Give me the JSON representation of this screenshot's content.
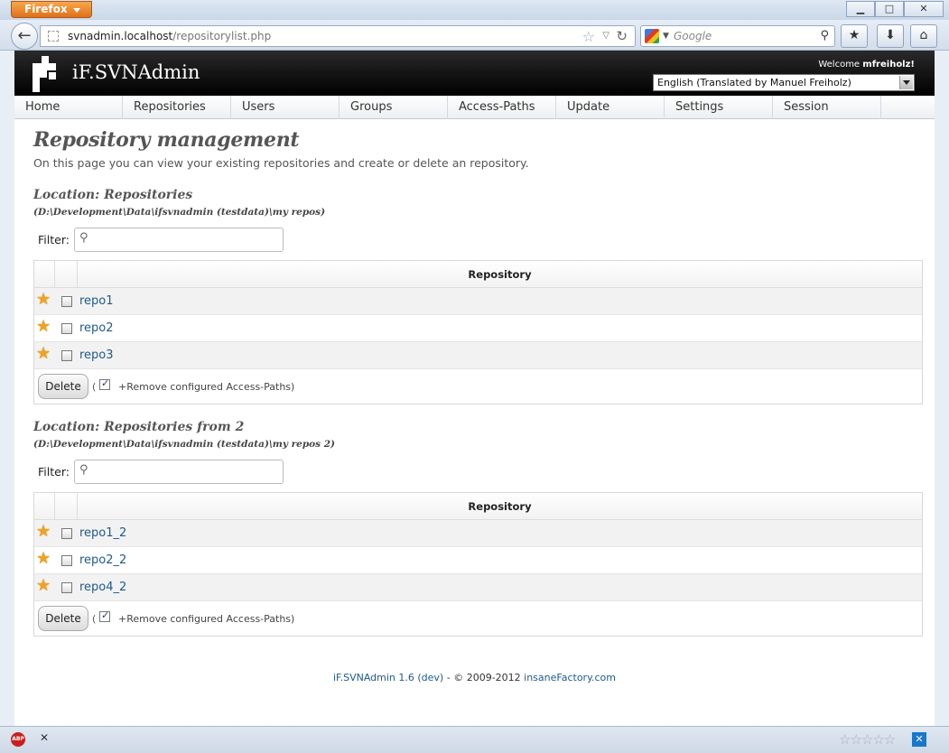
{
  "browser": {
    "menu_button": "Firefox",
    "url_host": "svnadmin.localhost",
    "url_path": "/repositorylist.php",
    "search_placeholder": "Google"
  },
  "header": {
    "brand": "iF.SVNAdmin",
    "welcome_text": "Welcome",
    "username": "mfreiholz!",
    "language": "English (Translated by Manuel Freiholz)"
  },
  "menu": [
    "Home",
    "Repositories",
    "Users",
    "Groups",
    "Access-Paths",
    "Update",
    "Settings",
    "Session"
  ],
  "main": {
    "title": "Repository management",
    "description": "On this page you can view your existing repositories and create or delete an repository."
  },
  "locations": [
    {
      "title": "Location: Repositories",
      "path": "(D:\\Development\\Data\\ifsvnadmin (testdata)\\my repos)",
      "filter_label": "Filter:",
      "column_header": "Repository",
      "repos": [
        "repo1",
        "repo2",
        "repo3"
      ],
      "delete_label": "Delete",
      "paren": "(",
      "remove_label": "+Remove configured Access-Paths)"
    },
    {
      "title": "Location: Repositories from 2",
      "path": "(D:\\Development\\Data\\ifsvnadmin (testdata)\\my repos 2)",
      "filter_label": "Filter:",
      "column_header": "Repository",
      "repos": [
        "repo1_2",
        "repo2_2",
        "repo4_2"
      ],
      "delete_label": "Delete",
      "paren": "(",
      "remove_label": "+Remove configured Access-Paths)"
    }
  ],
  "footer": {
    "app_link": "iF.SVNAdmin 1.6 (dev)",
    "copyright": " - © 2009-2012 ",
    "company_link": "insaneFactory.com"
  },
  "status": {
    "abp": "ABP",
    "rating": "☆☆☆☆☆"
  }
}
